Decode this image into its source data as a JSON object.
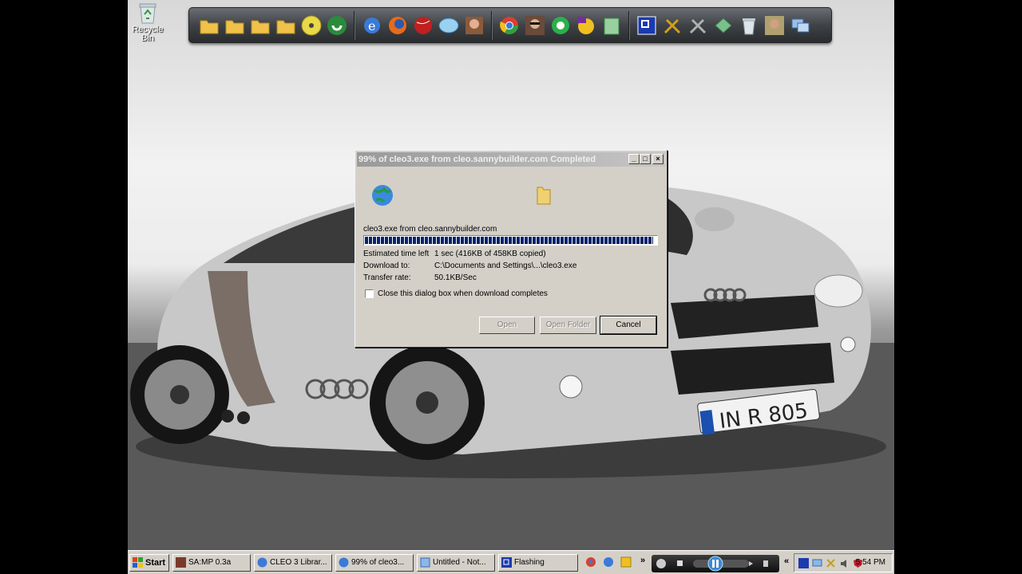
{
  "desktop": {
    "recycle_bin_label": "Recycle Bin"
  },
  "dock": {
    "icons": [
      "folder-icon",
      "folder-icon",
      "folder-icon",
      "folder-icon",
      "cd-icon",
      "torrent-icon",
      "internet-explorer-icon",
      "firefox-icon",
      "game-icon",
      "messenger-icon",
      "game-icon",
      "chrome-icon",
      "avatar-icon",
      "media-icon",
      "yahoo-messenger-icon",
      "recycle-icon",
      "app-icon",
      "tools-icon",
      "tools-icon",
      "gem-icon",
      "trash-icon",
      "avatar-icon",
      "network-icon"
    ]
  },
  "dialog": {
    "title": "99% of cleo3.exe from cleo.sannybuilder.com Completed",
    "file_label": "cleo3.exe from cleo.sannybuilder.com",
    "progress_percent": 99,
    "estimated_label": "Estimated time left",
    "estimated_value": "1 sec (416KB of 458KB copied)",
    "download_to_label": "Download to:",
    "download_to_value": "C:\\Documents and Settings\\...\\cleo3.exe",
    "transfer_rate_label": "Transfer rate:",
    "transfer_rate_value": "50.1KB/Sec",
    "checkbox_label": "Close this dialog box when download completes",
    "checkbox_checked": false,
    "buttons": {
      "open": "Open",
      "open_folder": "Open Folder",
      "cancel": "Cancel"
    }
  },
  "taskbar": {
    "start_label": "Start",
    "tasks": [
      {
        "label": "SA:MP 0.3a"
      },
      {
        "label": "CLEO 3 Librar..."
      },
      {
        "label": "99% of cleo3..."
      },
      {
        "label": "Untitled - Not..."
      },
      {
        "label": "Flashing"
      }
    ],
    "clock": "5:54 PM"
  },
  "colors": {
    "progress": "#0a246a",
    "taskbar": "#d4d0c8",
    "dock": "#3f4246"
  }
}
